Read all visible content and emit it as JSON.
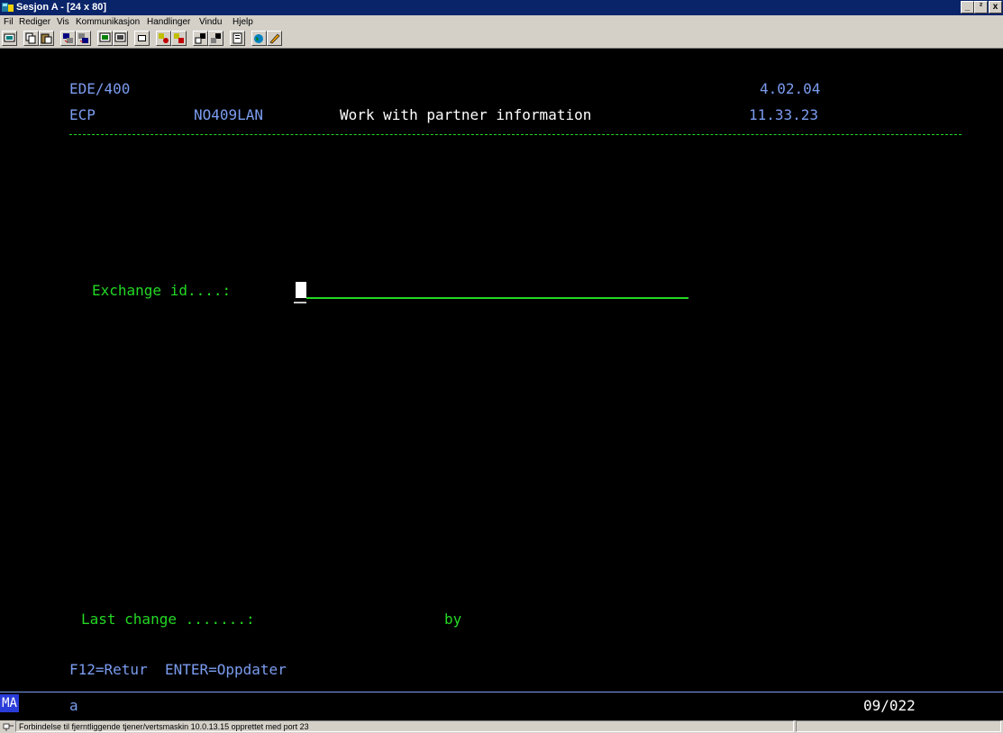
{
  "window": {
    "title": "Sesjon A - [24 x 80]",
    "buttons": {
      "minimize": "_",
      "maximize": "²",
      "close": "x"
    }
  },
  "menu": {
    "items": [
      {
        "label": "Fil"
      },
      {
        "label": "Rediger"
      },
      {
        "label": "Vis"
      },
      {
        "label": "Kommunikasjon"
      },
      {
        "label": "Handlinger"
      },
      {
        "label": "Vindu"
      },
      {
        "label": "Hjelp"
      }
    ]
  },
  "toolbar": {
    "icons": [
      "print-screen-icon",
      "copy-icon",
      "paste-icon",
      "send-icon",
      "receive-icon",
      "display-icon",
      "keyboard-icon",
      "macro-icon",
      "record-icon",
      "play-icon",
      "transfer-icon",
      "download-icon",
      "clipboard-icon",
      "globe-icon",
      "edit-icon"
    ]
  },
  "screen": {
    "header": {
      "system": "EDE/400",
      "version": "4.02.04",
      "module": "ECP",
      "user": "NO409LAN",
      "title": "Work with partner information",
      "time": "11.33.23"
    },
    "field": {
      "label": "Exchange id....:",
      "value": ""
    },
    "last_change": {
      "label": "Last change .......:",
      "by_label": "by"
    },
    "function_keys": "F12=Retur  ENTER=Oppdater"
  },
  "oia": {
    "indicator": "MA",
    "input_char": "a",
    "cursor_position": "09/022"
  },
  "statusbar": {
    "message": "Forbindelse til fjerntliggende tjener/vertsmaskin 10.0.13.15 opprettet med port 23"
  },
  "colors": {
    "terminal_bg": "#000000",
    "field_green": "#24d824",
    "header_blue": "#7b9cf0",
    "title_bar": "#0a246a"
  }
}
